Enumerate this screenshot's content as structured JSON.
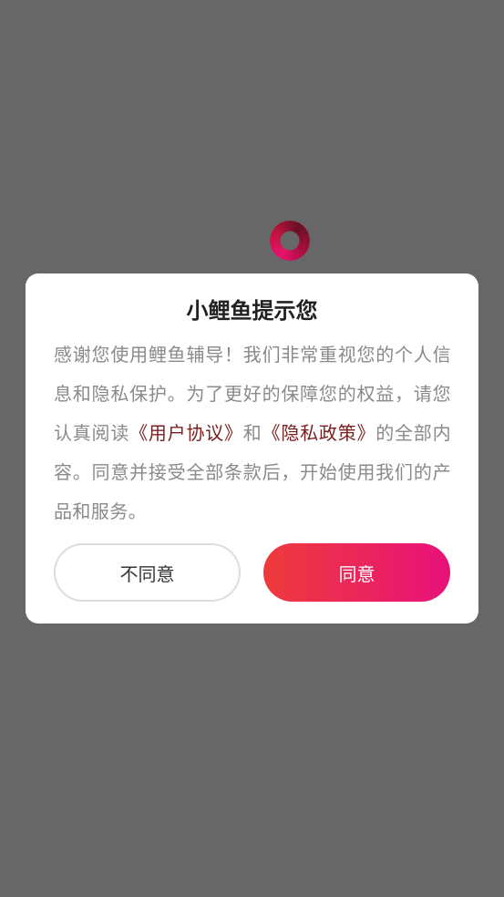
{
  "dialog": {
    "title": "小鲤鱼提示您",
    "body": {
      "intro": "感谢您使用鲤鱼辅导！我们非常重视您的个人信息和隐私保护。为了更好的保障您的权益，请您认真阅读",
      "user_agreement_link": "《用户协议》",
      "conjunction": "和",
      "privacy_policy_link": "《隐私政策》",
      "outro": "的全部内容。同意并接受全部条款后，开始使用我们的产品和服务。"
    },
    "buttons": {
      "disagree": "不同意",
      "agree": "同意"
    }
  },
  "colors": {
    "overlay": "#676767",
    "link": "#7a2020",
    "agree_gradient_start": "#ee3b3b",
    "agree_gradient_end": "#e8117a"
  },
  "icons": {
    "loading": "loading-spinner-icon"
  }
}
